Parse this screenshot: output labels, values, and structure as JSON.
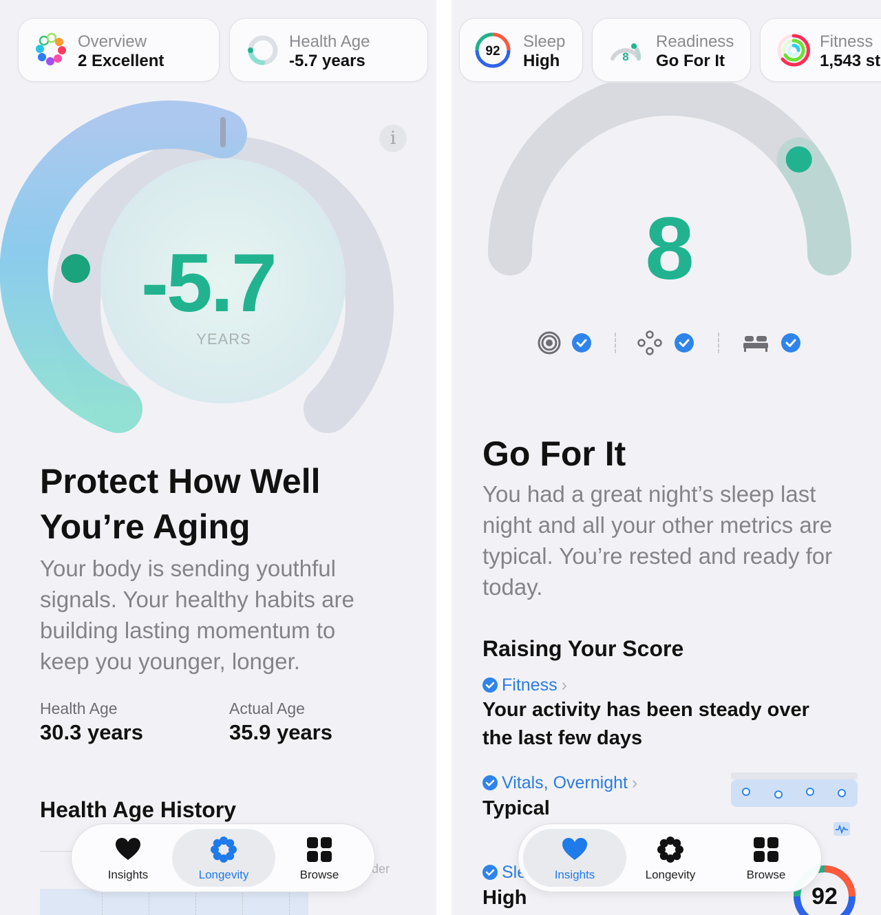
{
  "left": {
    "chips": [
      {
        "label": "Overview",
        "value": "2 Excellent",
        "icon": "overview-flower-icon"
      },
      {
        "label": "Health Age",
        "value": "-5.7 years",
        "icon": "health-age-ring-icon"
      }
    ],
    "gauge": {
      "value_text": "-5.7",
      "unit": "YEARS",
      "indicator_fraction": 0.2
    },
    "headline": [
      "Protect How Well",
      "You’re Aging"
    ],
    "body": [
      "Your body is sending youthful",
      "signals. Your healthy habits are",
      "building lasting momentum to",
      "keep you younger, longer."
    ],
    "stats": [
      {
        "label": "Health Age",
        "value": "30.3 years"
      },
      {
        "label": "Actual Age",
        "value": "35.9 years"
      }
    ],
    "history_title": "Health Age History",
    "peek_text": "der",
    "tabs": [
      {
        "label": "Insights",
        "icon": "heart-icon",
        "active": false
      },
      {
        "label": "Longevity",
        "icon": "flower-icon",
        "active": true
      },
      {
        "label": "Browse",
        "icon": "grid-icon",
        "active": false
      }
    ]
  },
  "right": {
    "chips": [
      {
        "label": "Sleep",
        "value": "High",
        "badge": "92",
        "icon": "sleep-score-ring-icon"
      },
      {
        "label": "Readiness",
        "value": "Go For It",
        "badge": "8",
        "icon": "readiness-gauge-icon"
      },
      {
        "label": "Fitness",
        "value": "1,543 st",
        "icon": "activity-rings-icon"
      }
    ],
    "gauge": {
      "value_text": "8",
      "score": 8,
      "max": 10
    },
    "metric_icons": [
      "breathing-target-icon",
      "vitals-cluster-icon",
      "bed-icon"
    ],
    "headline": "Go For It",
    "body": [
      "You had a great night’s sleep last",
      "night and all your other metrics are",
      "typical. You’re rested and ready for",
      "today."
    ],
    "section_title": "Raising Your Score",
    "items": [
      {
        "source": "Fitness",
        "text": [
          "Your activity has been steady over",
          "the last few days"
        ]
      },
      {
        "source": "Vitals, Overnight",
        "text": [
          "Typical"
        ]
      },
      {
        "source": "Sle",
        "text": [
          "High"
        ]
      }
    ],
    "sleep_badge": "92",
    "tabs": [
      {
        "label": "Insights",
        "icon": "heart-icon",
        "active": true
      },
      {
        "label": "Longevity",
        "icon": "flower-icon",
        "active": false
      },
      {
        "label": "Browse",
        "icon": "grid-icon",
        "active": false
      }
    ],
    "colors": {
      "accent_teal": "#21b38f",
      "link_blue": "#2a7be4",
      "check_blue": "#2f84ea"
    }
  }
}
